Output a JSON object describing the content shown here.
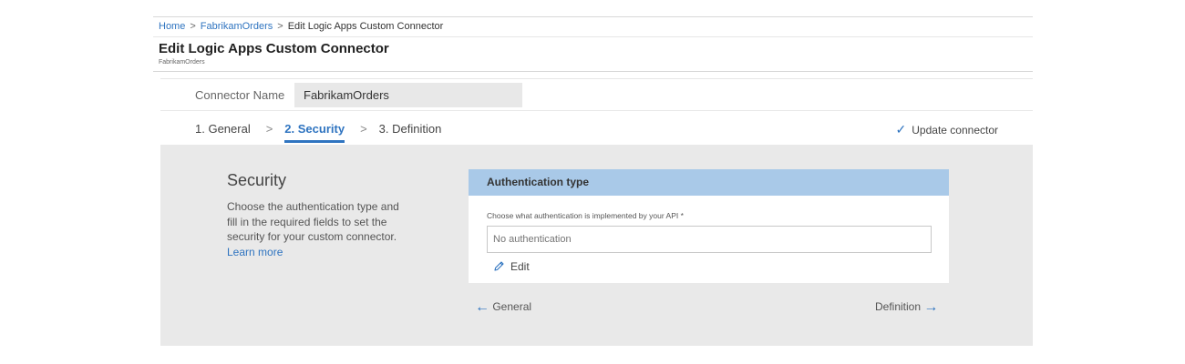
{
  "breadcrumb": {
    "items": [
      "Home",
      "FabrikamOrders",
      "Edit Logic Apps Custom Connector"
    ],
    "separator": ">"
  },
  "page": {
    "title": "Edit Logic Apps Custom Connector",
    "subtitle": "FabrikamOrders"
  },
  "connector": {
    "name_label": "Connector Name",
    "name_value": "FabrikamOrders"
  },
  "steps": {
    "items": [
      "1. General",
      "2. Security",
      "3. Definition"
    ],
    "active_index": 1,
    "separator": ">"
  },
  "update": {
    "icon": "checkmark-icon",
    "label": "Update connector"
  },
  "security": {
    "title": "Security",
    "description": "Choose the authentication type and fill in the required fields to set the security for your custom connector.",
    "learn_more": "Learn more"
  },
  "auth": {
    "header": "Authentication type",
    "field_label": "Choose what authentication is implemented by your API *",
    "placeholder": "No authentication",
    "edit_label": "Edit",
    "edit_icon": "pencil-icon"
  },
  "nav": {
    "prev_label": "General",
    "next_label": "Definition",
    "prev_icon": "arrow-left-icon",
    "next_icon": "arrow-right-icon"
  },
  "colors": {
    "accent": "#2f74c0",
    "card_header": "#a9c9e8",
    "panel_bg": "#e9e9e9"
  }
}
